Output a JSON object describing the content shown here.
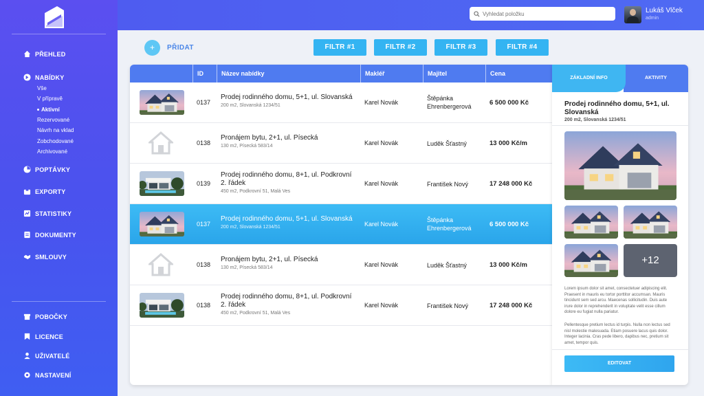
{
  "sidebar": {
    "items": [
      {
        "label": "PŘEHLED",
        "icon": "home-icon"
      },
      {
        "label": "NABÍDKY",
        "icon": "arrow-circle-icon"
      },
      {
        "label": "POPTÁVKY",
        "icon": "pie-chart-icon"
      },
      {
        "label": "EXPORTY",
        "icon": "export-icon"
      },
      {
        "label": "STATISTIKY",
        "icon": "chart-icon"
      },
      {
        "label": "DOKUMENTY",
        "icon": "document-icon"
      },
      {
        "label": "SMLOUVY",
        "icon": "handshake-icon"
      }
    ],
    "subitems": [
      "Vše",
      "V přípravě",
      "Aktivní",
      "Rezervované",
      "Návrh na vklad",
      "Zobchodované",
      "Archivované"
    ],
    "bottom_items": [
      {
        "label": "POBOČKY",
        "icon": "store-icon"
      },
      {
        "label": "LICENCE",
        "icon": "bookmark-icon"
      },
      {
        "label": "UŽIVATELÉ",
        "icon": "users-icon"
      },
      {
        "label": "NASTAVENÍ",
        "icon": "gear-icon"
      }
    ]
  },
  "header": {
    "search_placeholder": "Vyhledat položku",
    "user_name": "Lukáš Vlček",
    "user_role": "admin"
  },
  "toolbar": {
    "add_label": "PŘIDAT",
    "add_icon": "+",
    "filters": [
      "FILTR #1",
      "FILTR #2",
      "FILTR #3",
      "FILTR #4"
    ]
  },
  "table": {
    "columns": [
      "ID",
      "Název nabídky",
      "Makléř",
      "Majitel",
      "Cena"
    ],
    "rows": [
      {
        "id": "0137",
        "title": "Prodej rodinného domu, 5+1, ul. Slovanská",
        "subtitle": "200 m2, Slovanská 1234/51",
        "agent": "Karel Novák",
        "owner": "Štěpánka Ehrenbergerová",
        "price": "6 500 000 Kč",
        "image": "house-photo"
      },
      {
        "id": "0138",
        "title": "Pronájem bytu, 2+1, ul. Písecká",
        "subtitle": "130 m2, Písecká 583/14",
        "agent": "Karel Novák",
        "owner": "Luděk Šťastný",
        "price": "13 000 Kč/m",
        "image": "placeholder"
      },
      {
        "id": "0139",
        "title": "Prodej rodinného domu, 8+1, ul. Podkrovní 2. řádek",
        "subtitle": "450 m2, Podkrovní 51, Malá Ves",
        "agent": "Karel Novák",
        "owner": "František Nový",
        "price": "17 248 000 Kč",
        "image": "villa-photo"
      },
      {
        "id": "0137",
        "title": "Prodej rodinného domu, 5+1, ul. Slovanská",
        "subtitle": "200 m2, Slovanská 1234/51",
        "agent": "Karel Novák",
        "owner": "Štěpánka Ehrenbergerová",
        "price": "6 500 000 Kč",
        "image": "house-photo"
      },
      {
        "id": "0138",
        "title": "Pronájem bytu, 2+1, ul. Písecká",
        "subtitle": "130 m2, Písecká 583/14",
        "agent": "Karel Novák",
        "owner": "Luděk Šťastný",
        "price": "13 000 Kč/m",
        "image": "placeholder"
      },
      {
        "id": "0138",
        "title": "Prodej rodinného domu, 8+1, ul. Podkrovní 2. řádek",
        "subtitle": "450 m2, Podkrovní 51, Malá Ves",
        "agent": "Karel Novák",
        "owner": "František Nový",
        "price": "17 248 000 Kč",
        "image": "villa-photo"
      }
    ]
  },
  "panel": {
    "tabs": [
      "ZÁKLADNÍ INFO",
      "AKTIVITY"
    ],
    "title": "Prodej rodinného domu, 5+1, ul. Slovanská",
    "subtitle": "200 m2, Slovanská 1234/51",
    "more_count": "+12",
    "text1": "Lorem ipsum dolor sit amet, consectetuer adipiscing elit. Praesent in mauris eu tortor porttitor accumsan. Mauris tincidunt sem sed arcu. Maecenas sollicitudin. Duis aute irure dolor in reprehenderit in voluptate velit esse cillum dolore eu fugiat nulla pariatur.",
    "text2": "Pellentesque pretium lectus id turpis. Nulla non lectus sed nisl molestie malesuada. Etiam posuere lacus quis dolor. Integer lacinia. Cras pede libero, dapibus nec, pretium sit amet, tempor quis.",
    "edit_label": "EDITOVAT"
  },
  "colors": {
    "primary": "#4f7bf0",
    "accent": "#34b4f2",
    "sidebar": "#4a52ee"
  }
}
